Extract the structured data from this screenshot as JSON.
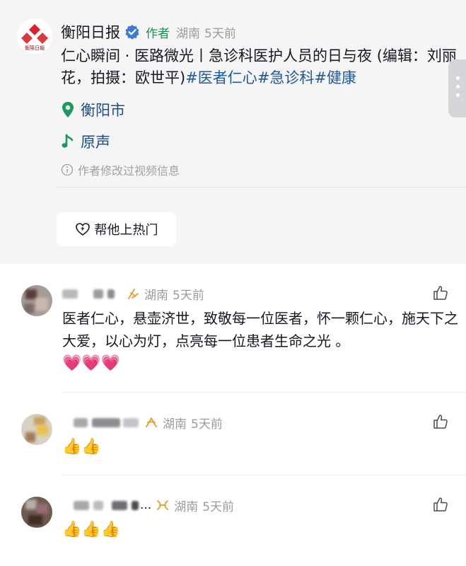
{
  "post": {
    "author": "衡阳日报",
    "author_tag": "作者",
    "location": "湖南",
    "time": "5天前",
    "description": "仁心瞬间 · 医路微光丨急诊科医护人员的日与夜 (编辑：刘丽花，拍摄：欧世平)",
    "tags": [
      "#医者仁心",
      "#急诊科",
      "#健康"
    ],
    "place": "衡阳市",
    "music": "原声",
    "edited_note": "作者修改过视频信息",
    "hot_button": "帮他上热门",
    "logo_text": "衡陽日報"
  },
  "comments": [
    {
      "location": "湖南",
      "time": "5天前",
      "text": "医者仁心，悬壶济世，致敬每一位医者，怀一颗仁心，施天下之大爱，以心为灯，点亮每一位患者生命之光 。",
      "emoji": "💗💗💗"
    },
    {
      "location": "湖南",
      "time": "5天前",
      "text": "",
      "emoji": "👍👍"
    },
    {
      "location": "湖南",
      "time": "5天前",
      "name_suffix": "...",
      "text": "",
      "emoji": "👍👍👍"
    }
  ],
  "colors": {
    "accent_green": "#1c8f59",
    "tag_blue": "#1c5a9e",
    "verified_blue": "#3a7bd5",
    "fan_badge": "#e8a43a",
    "gray_text": "#9a9ba0"
  },
  "icons": [
    "verified-icon",
    "location-pin-icon",
    "music-note-icon",
    "info-icon",
    "heart-fire-icon",
    "thumbs-up-icon",
    "fan-badge-icon"
  ]
}
